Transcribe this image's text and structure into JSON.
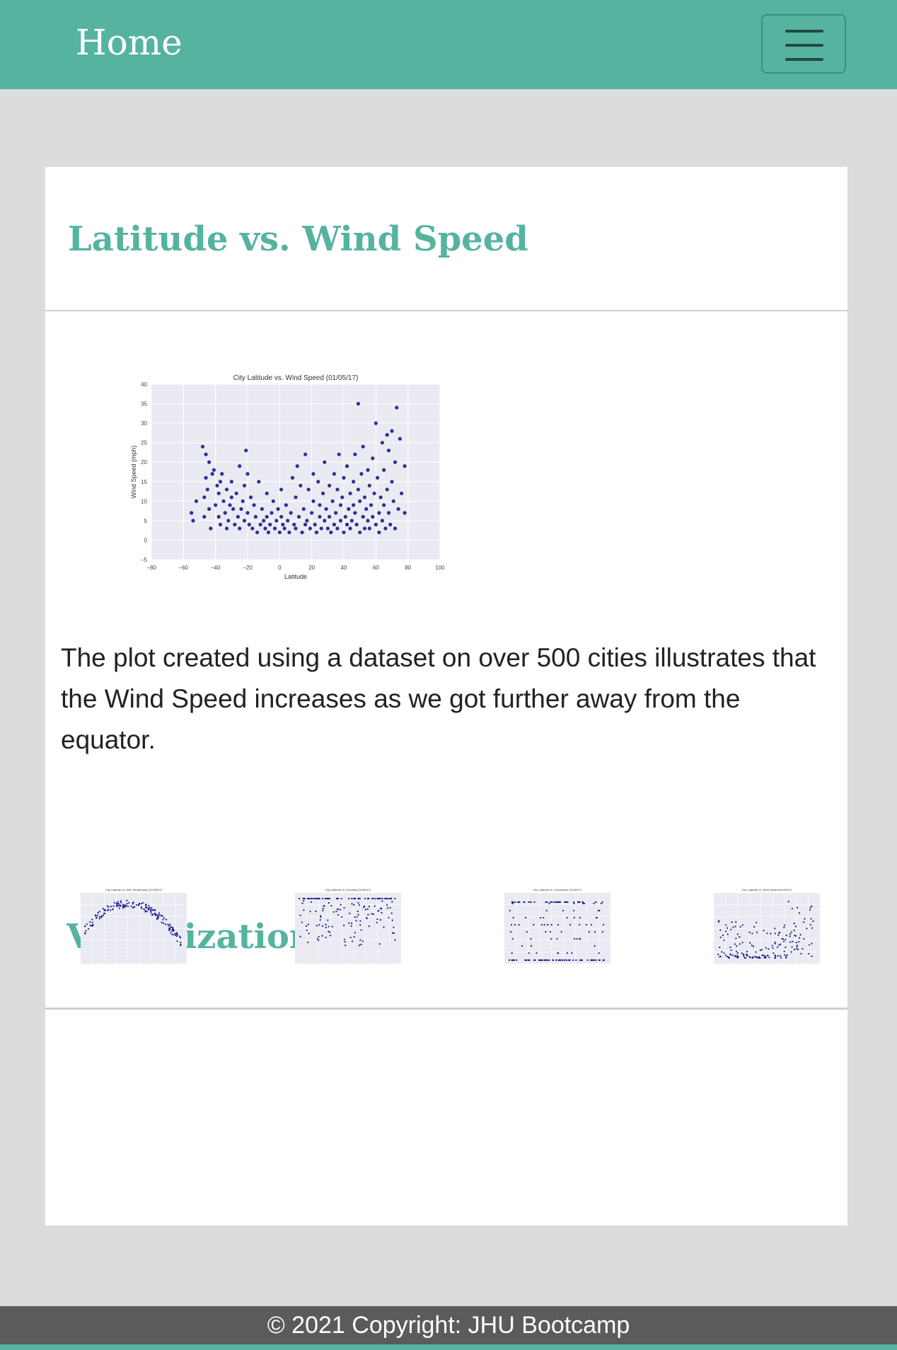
{
  "navbar": {
    "brand": "Home",
    "toggle_icon": "hamburger-icon"
  },
  "colors": {
    "accent": "#56b3a0",
    "background": "#dcdcdc",
    "footer": "#5b5b5b",
    "point": "#1a1a8c",
    "plot_bg": "#eaeaf2"
  },
  "section": {
    "title": "Latitude vs. Wind Speed",
    "description": "The plot created using a dataset on over 500 cities illustrates that the Wind Speed increases as we got further away from the equator."
  },
  "visualizations": {
    "title": "Visualizations",
    "thumbnails": [
      {
        "title": "City Latitude vs. Max Temperature (01/05/17)",
        "metric": "temperature"
      },
      {
        "title": "City Latitude vs. Humidity (01/05/17)",
        "metric": "humidity"
      },
      {
        "title": "City Latitude vs. Cloudiness (01/05/17)",
        "metric": "cloudiness"
      },
      {
        "title": "City Latitude vs. Wind Speed (01/05/17)",
        "metric": "wind"
      }
    ]
  },
  "chart_data": {
    "type": "scatter",
    "title": "City Latitude vs. Wind Speed (01/05/17)",
    "xlabel": "Latitude",
    "ylabel": "Wind Speed (mph)",
    "xlim": [
      -80,
      100
    ],
    "ylim": [
      -5,
      40
    ],
    "xticks": [
      "−80",
      "−60",
      "−40",
      "−20",
      "0",
      "20",
      "40",
      "60",
      "80",
      "100"
    ],
    "yticks": [
      "−5",
      "0",
      "5",
      "10",
      "15",
      "20",
      "25",
      "30",
      "35",
      "40"
    ],
    "grid": true,
    "points": [
      [
        -55,
        7
      ],
      [
        -54,
        5
      ],
      [
        -52,
        10
      ],
      [
        -48,
        24
      ],
      [
        -47,
        6
      ],
      [
        -47,
        11
      ],
      [
        -46,
        16
      ],
      [
        -46,
        22
      ],
      [
        -45,
        13
      ],
      [
        -44,
        8
      ],
      [
        -44,
        20
      ],
      [
        -43,
        3
      ],
      [
        -42,
        17
      ],
      [
        -41,
        18
      ],
      [
        -40,
        9
      ],
      [
        -39,
        14
      ],
      [
        -38,
        12
      ],
      [
        -38,
        6
      ],
      [
        -37,
        15
      ],
      [
        -37,
        4
      ],
      [
        -36,
        17
      ],
      [
        -35,
        10
      ],
      [
        -34,
        7
      ],
      [
        -33,
        13
      ],
      [
        -33,
        3
      ],
      [
        -32,
        5
      ],
      [
        -31,
        9
      ],
      [
        -30,
        11
      ],
      [
        -30,
        15
      ],
      [
        -29,
        8
      ],
      [
        -28,
        4
      ],
      [
        -27,
        12
      ],
      [
        -26,
        6
      ],
      [
        -25,
        19
      ],
      [
        -25,
        3
      ],
      [
        -24,
        8
      ],
      [
        -23,
        10
      ],
      [
        -22,
        14
      ],
      [
        -22,
        5
      ],
      [
        -21,
        23
      ],
      [
        -20,
        17
      ],
      [
        -20,
        7
      ],
      [
        -19,
        4
      ],
      [
        -18,
        11
      ],
      [
        -17,
        3
      ],
      [
        -16,
        9
      ],
      [
        -15,
        6
      ],
      [
        -14,
        2
      ],
      [
        -13,
        15
      ],
      [
        -12,
        4
      ],
      [
        -11,
        8
      ],
      [
        -10,
        5
      ],
      [
        -9,
        3
      ],
      [
        -8,
        12
      ],
      [
        -8,
        6
      ],
      [
        -7,
        2
      ],
      [
        -6,
        4
      ],
      [
        -5,
        7
      ],
      [
        -4,
        10
      ],
      [
        -3,
        3
      ],
      [
        -2,
        5
      ],
      [
        -1,
        8
      ],
      [
        0,
        2
      ],
      [
        1,
        13
      ],
      [
        1,
        6
      ],
      [
        2,
        4
      ],
      [
        3,
        3
      ],
      [
        4,
        9
      ],
      [
        5,
        5
      ],
      [
        6,
        2
      ],
      [
        7,
        7
      ],
      [
        8,
        16
      ],
      [
        9,
        4
      ],
      [
        10,
        11
      ],
      [
        10,
        3
      ],
      [
        11,
        19
      ],
      [
        12,
        6
      ],
      [
        13,
        14
      ],
      [
        14,
        2
      ],
      [
        15,
        8
      ],
      [
        16,
        22
      ],
      [
        16,
        4
      ],
      [
        17,
        5
      ],
      [
        18,
        13
      ],
      [
        19,
        3
      ],
      [
        20,
        7
      ],
      [
        21,
        10
      ],
      [
        21,
        17
      ],
      [
        22,
        4
      ],
      [
        23,
        2
      ],
      [
        24,
        15
      ],
      [
        25,
        6
      ],
      [
        25,
        9
      ],
      [
        26,
        3
      ],
      [
        27,
        12
      ],
      [
        28,
        5
      ],
      [
        28,
        20
      ],
      [
        29,
        8
      ],
      [
        30,
        3
      ],
      [
        31,
        14
      ],
      [
        31,
        6
      ],
      [
        32,
        2
      ],
      [
        33,
        10
      ],
      [
        34,
        17
      ],
      [
        34,
        4
      ],
      [
        35,
        7
      ],
      [
        36,
        13
      ],
      [
        36,
        3
      ],
      [
        37,
        22
      ],
      [
        38,
        5
      ],
      [
        38,
        9
      ],
      [
        39,
        11
      ],
      [
        40,
        2
      ],
      [
        40,
        16
      ],
      [
        41,
        6
      ],
      [
        42,
        4
      ],
      [
        42,
        19
      ],
      [
        43,
        8
      ],
      [
        44,
        12
      ],
      [
        44,
        3
      ],
      [
        45,
        5
      ],
      [
        46,
        15
      ],
      [
        46,
        9
      ],
      [
        47,
        7
      ],
      [
        47,
        22
      ],
      [
        48,
        4
      ],
      [
        49,
        35
      ],
      [
        49,
        13
      ],
      [
        50,
        10
      ],
      [
        50,
        2
      ],
      [
        51,
        17
      ],
      [
        52,
        6
      ],
      [
        52,
        24
      ],
      [
        53,
        3
      ],
      [
        53,
        11
      ],
      [
        54,
        8
      ],
      [
        55,
        18
      ],
      [
        55,
        5
      ],
      [
        56,
        14
      ],
      [
        56,
        3
      ],
      [
        57,
        9
      ],
      [
        58,
        21
      ],
      [
        58,
        6
      ],
      [
        59,
        12
      ],
      [
        60,
        4
      ],
      [
        60,
        30
      ],
      [
        61,
        16
      ],
      [
        62,
        7
      ],
      [
        62,
        2
      ],
      [
        63,
        11
      ],
      [
        64,
        25
      ],
      [
        64,
        5
      ],
      [
        65,
        9
      ],
      [
        65,
        18
      ],
      [
        66,
        3
      ],
      [
        67,
        27
      ],
      [
        67,
        13
      ],
      [
        68,
        7
      ],
      [
        68,
        23
      ],
      [
        69,
        4
      ],
      [
        70,
        15
      ],
      [
        70,
        28
      ],
      [
        71,
        10
      ],
      [
        72,
        3
      ],
      [
        72,
        20
      ],
      [
        73,
        34
      ],
      [
        74,
        8
      ],
      [
        75,
        26
      ],
      [
        76,
        12
      ],
      [
        78,
        19
      ],
      [
        78,
        7
      ]
    ]
  }
}
